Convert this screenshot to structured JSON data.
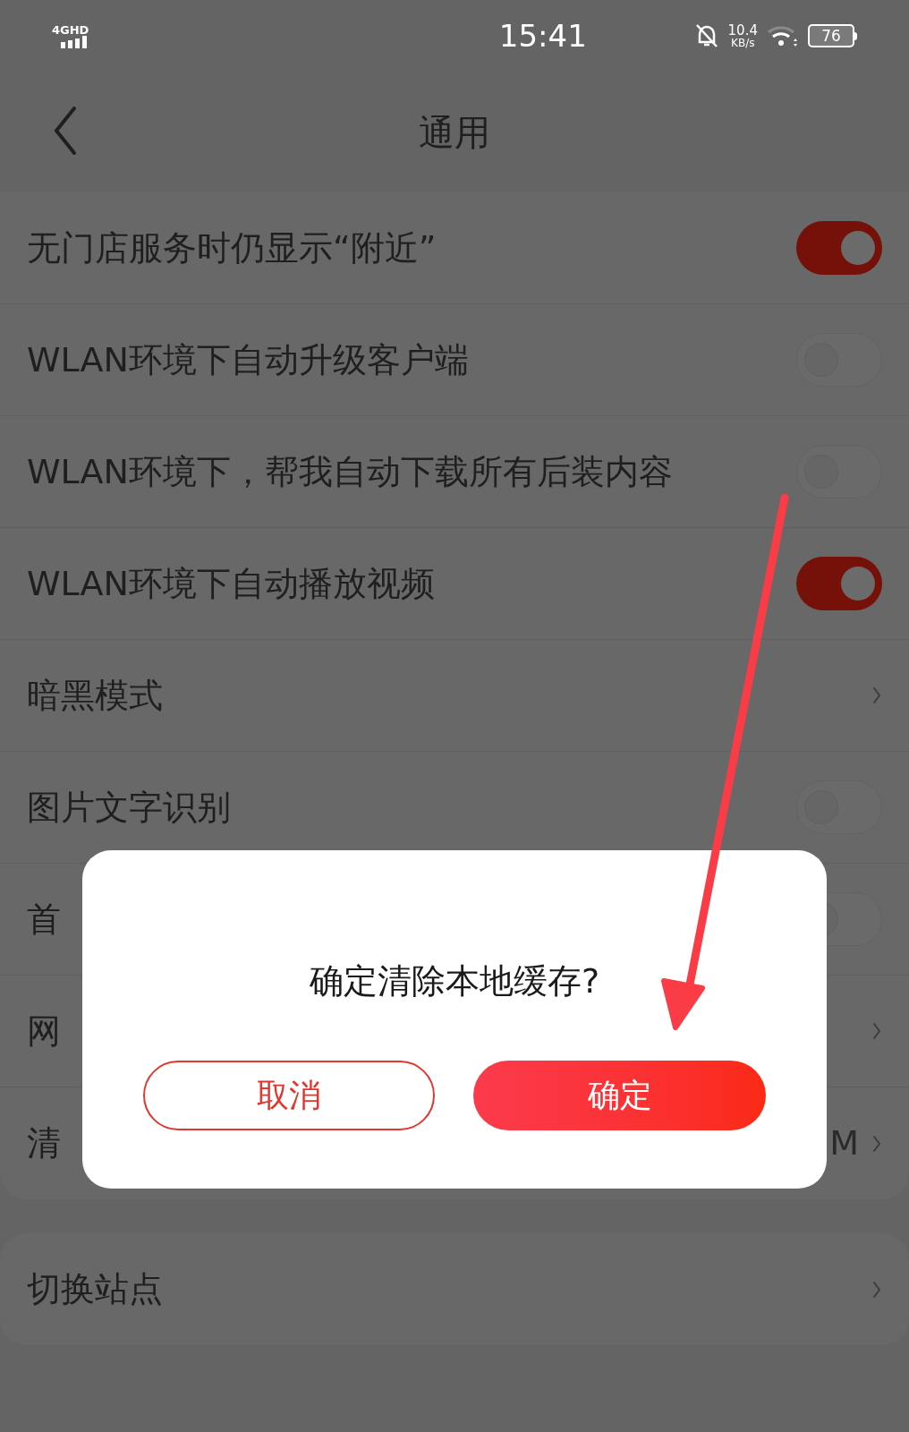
{
  "status_bar": {
    "network": "4GHD",
    "time": "15:41",
    "speed": "10.4",
    "speed_unit": "KB/s",
    "battery": "76"
  },
  "header": {
    "title": "通用"
  },
  "settings": [
    {
      "label": "无门店服务时仍显示“附近”",
      "kind": "toggle",
      "on": true
    },
    {
      "label": "WLAN环境下自动升级客户端",
      "kind": "toggle",
      "on": false
    },
    {
      "label": "WLAN环境下，帮我自动下载所有后装内容",
      "kind": "toggle",
      "on": false
    },
    {
      "label": "WLAN环境下自动播放视频",
      "kind": "toggle",
      "on": true
    },
    {
      "label": "暗黑模式",
      "kind": "link"
    },
    {
      "label": "图片文字识别",
      "kind": "toggle",
      "on": false
    },
    {
      "label": "首",
      "kind": "toggle",
      "on": false
    },
    {
      "label": "网",
      "kind": "link"
    },
    {
      "label": "清",
      "kind": "link",
      "value": "M"
    }
  ],
  "settings_2": [
    {
      "label": "切换站点",
      "kind": "link"
    }
  ],
  "dialog": {
    "message": "确定清除本地缓存?",
    "cancel": "取消",
    "confirm": "确定"
  }
}
